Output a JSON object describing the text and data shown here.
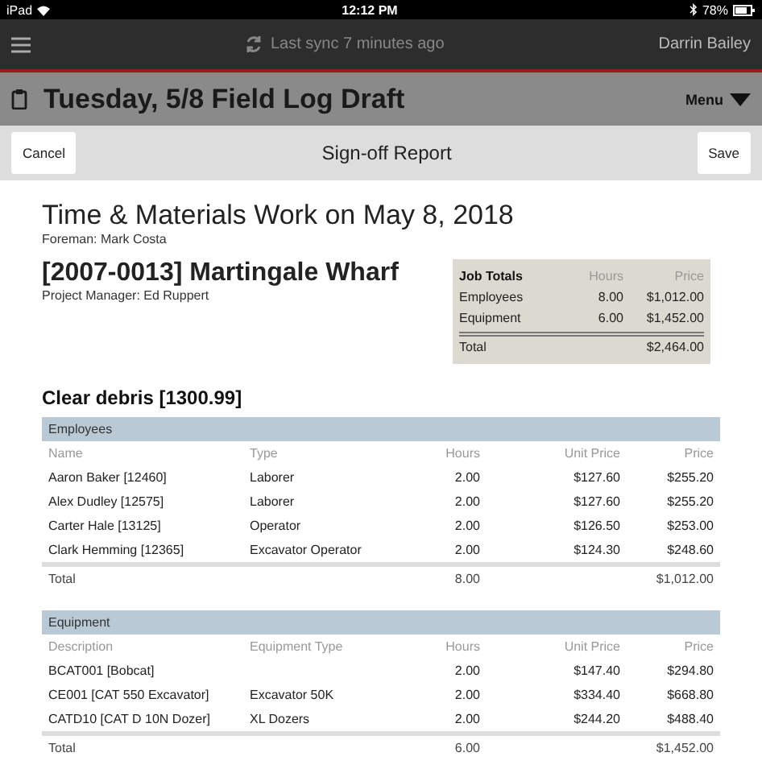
{
  "status_bar": {
    "device": "iPad",
    "time": "12:12 PM",
    "battery": "78%"
  },
  "top_bar": {
    "sync": "Last sync 7 minutes ago",
    "user": "Darrin Bailey"
  },
  "title_bar": {
    "title": "Tuesday, 5/8 Field Log Draft",
    "menu": "Menu"
  },
  "nav_bar": {
    "left_button": "Cancel",
    "title": "Sign-off Report",
    "right_button": "Save"
  },
  "report": {
    "title": "Time & Materials Work on May 8, 2018",
    "foreman": "Foreman: Mark Costa",
    "project": "[2007-0013] Martingale Wharf",
    "manager": "Project Manager: Ed Ruppert",
    "job_totals": {
      "columns": [
        "Job Totals",
        "Hours",
        "Price"
      ],
      "rows": [
        {
          "label": "Employees",
          "hours": "8.00",
          "price": "$1,012.00"
        },
        {
          "label": "Equipment",
          "hours": "6.00",
          "price": "$1,452.00"
        }
      ],
      "total": {
        "label": "Total",
        "price": "$2,464.00"
      }
    },
    "task": "Clear debris [1300.99]",
    "sections": [
      {
        "title": "Employees",
        "columns": [
          "Name",
          "Type",
          "Hours",
          "Unit Price",
          "Price"
        ],
        "rows": [
          {
            "name": "Aaron Baker [12460]",
            "type": "Laborer",
            "hours": "2.00",
            "unit_price": "$127.60",
            "price": "$255.20"
          },
          {
            "name": "Alex Dudley [12575]",
            "type": "Laborer",
            "hours": "2.00",
            "unit_price": "$127.60",
            "price": "$255.20"
          },
          {
            "name": "Carter Hale [13125]",
            "type": "Operator",
            "hours": "2.00",
            "unit_price": "$126.50",
            "price": "$253.00"
          },
          {
            "name": "Clark Hemming [12365]",
            "type": "Excavator Operator",
            "hours": "2.00",
            "unit_price": "$124.30",
            "price": "$248.60"
          }
        ],
        "total": {
          "label": "Total",
          "hours": "8.00",
          "price": "$1,012.00"
        }
      },
      {
        "title": "Equipment",
        "columns": [
          "Description",
          "Equipment Type",
          "Hours",
          "Unit Price",
          "Price"
        ],
        "rows": [
          {
            "name": "BCAT001 [Bobcat]",
            "hours": "2.00",
            "unit_price": "$147.40",
            "price": "$294.80"
          },
          {
            "name": "CE001 [CAT 550 Excavator]",
            "type": "Excavator 50K",
            "hours": "2.00",
            "unit_price": "$334.40",
            "price": "$668.80"
          },
          {
            "name": "CATD10 [CAT D 10N Dozer]",
            "type": "XL Dozers",
            "hours": "2.00",
            "unit_price": "$244.20",
            "price": "$488.40"
          }
        ],
        "total": {
          "label": "Total",
          "hours": "6.00",
          "price": "$1,452.00"
        }
      }
    ]
  }
}
